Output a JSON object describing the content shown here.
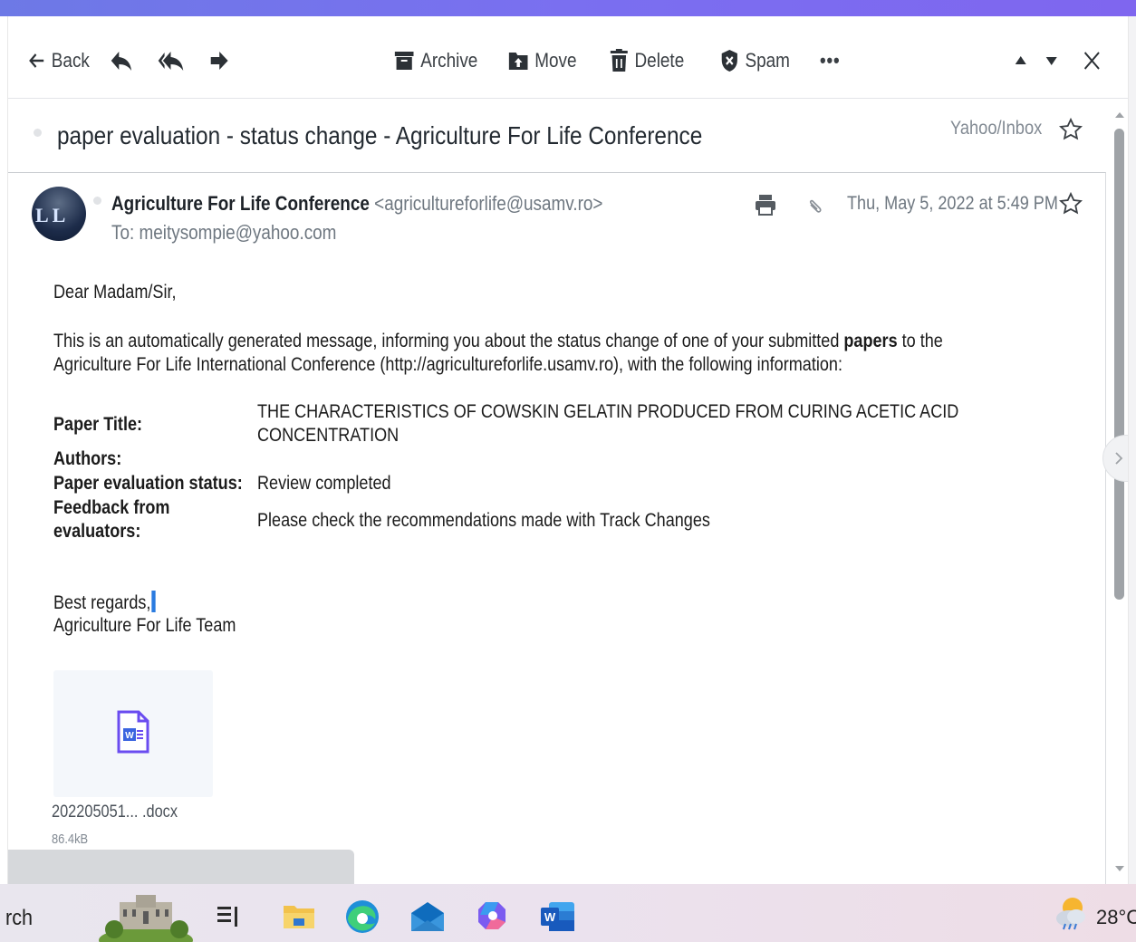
{
  "toolbar": {
    "back_label": "Back",
    "archive_label": "Archive",
    "move_label": "Move",
    "delete_label": "Delete",
    "spam_label": "Spam",
    "more_label": "•••"
  },
  "message": {
    "subject": "paper evaluation - status change - Agriculture For Life Conference",
    "folder": "Yahoo/Inbox",
    "sender_name": "Agriculture For Life Conference",
    "sender_email": "<agricultureforlife@usamv.ro>",
    "to": "To: meitysompie@yahoo.com",
    "date": "Thu, May 5, 2022 at 5:49 PM",
    "avatar_initials": "LL"
  },
  "body": {
    "greeting": "Dear Madam/Sir,",
    "intro_part1": "This is an automatically generated message, informing you about the status change of one of your submitted ",
    "intro_bold": "papers",
    "intro_part2": " to the",
    "intro_line2": "Agriculture For Life International Conference (http://agricultureforlife.usamv.ro), with the following information:",
    "paper_title_label": "Paper Title:",
    "paper_title_line1": "THE CHARACTERISTICS OF COWSKIN GELATIN PRODUCED FROM CURING ACETIC ACID",
    "paper_title_line2": "CONCENTRATION",
    "authors_label": "Authors:",
    "status_label": "Paper evaluation status:",
    "status_value": "Review completed",
    "feedback_label_line1": "Feedback from",
    "feedback_label_line2": "evaluators:",
    "feedback_value": "Please check the recommendations made with Track Changes",
    "closing": "Best regards,",
    "signature": "Agriculture For Life Team"
  },
  "attachment": {
    "name": "202205051... .docx",
    "size": "86.4kB",
    "icon": "word-doc-icon"
  },
  "taskbar": {
    "search_text": "rch",
    "temperature": "28°C"
  },
  "colors": {
    "accent": "#7a6ff0",
    "word_blue": "#2b579a",
    "attachment_icon": "#6a4cf0"
  }
}
